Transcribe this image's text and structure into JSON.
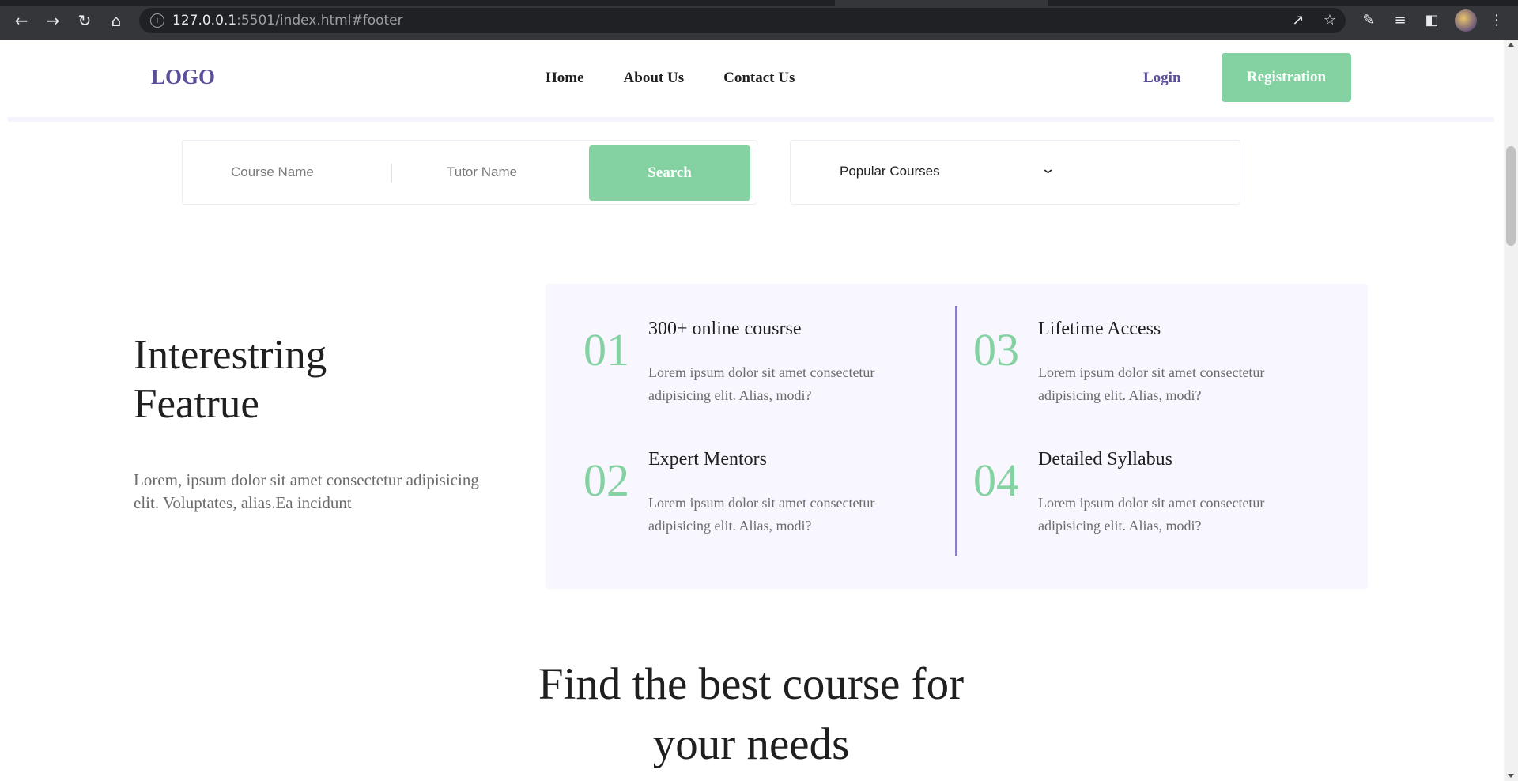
{
  "browser": {
    "url_host": "127.0.0.1",
    "url_rest": ":5501/index.html#footer"
  },
  "header": {
    "logo": "LOGO",
    "menu": [
      {
        "label": "Home"
      },
      {
        "label": "About Us"
      },
      {
        "label": "Contact Us"
      }
    ],
    "login": "Login",
    "registration": "Registration"
  },
  "search": {
    "course_placeholder": "Course Name",
    "tutor_placeholder": "Tutor Name",
    "button": "Search",
    "select_value": "Popular Courses"
  },
  "features": {
    "title_line1": "Interestring",
    "title_line2": "Featrue",
    "description": "Lorem, ipsum dolor sit amet consectetur adipisicing elit. Voluptates, alias.Ea incidunt",
    "items": [
      {
        "num": "01",
        "title": "300+ online cousrse",
        "text": "Lorem ipsum dolor sit amet consectetur adipisicing elit. Alias, modi?"
      },
      {
        "num": "02",
        "title": "Expert Mentors",
        "text": "Lorem ipsum dolor sit amet consectetur adipisicing elit. Alias, modi?"
      },
      {
        "num": "03",
        "title": "Lifetime Access",
        "text": "Lorem ipsum dolor sit amet consectetur adipisicing elit. Alias, modi?"
      },
      {
        "num": "04",
        "title": "Detailed Syllabus",
        "text": "Lorem ipsum dolor sit amet consectetur adipisicing elit. Alias, modi?"
      }
    ]
  },
  "courses": {
    "heading_line1": "Find the best course for",
    "heading_line2": "your needs"
  },
  "colors": {
    "brand": "#5b4e9b",
    "accent": "#84d1a1",
    "panel": "#f8f7ff"
  }
}
